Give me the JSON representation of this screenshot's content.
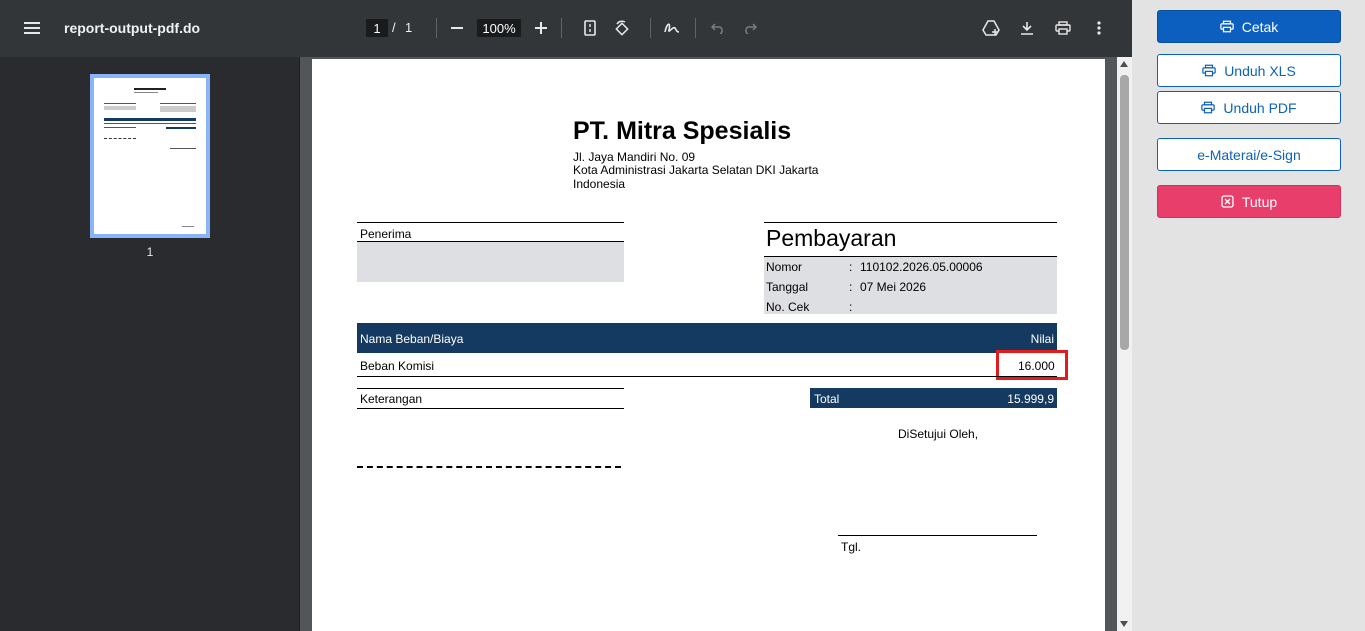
{
  "viewer": {
    "filename": "report-output-pdf.do",
    "current_page": "1",
    "page_separator": "/",
    "total_pages": "1",
    "zoom": "100%",
    "thumbnail_label": "1"
  },
  "document": {
    "company_name": "PT. Mitra Spesialis",
    "address_lines": [
      "Jl. Jaya Mandiri No. 09",
      "Kota Administrasi Jakarta Selatan DKI Jakarta",
      "Indonesia"
    ],
    "recipient_label": "Penerima",
    "payment_title": "Pembayaran",
    "fields": [
      {
        "label": "Nomor",
        "sep": ":",
        "value": "110102.2026.05.00006"
      },
      {
        "label": "Tanggal",
        "sep": ":",
        "value": "07 Mei 2026"
      },
      {
        "label": "No. Cek",
        "sep": ":",
        "value": ""
      }
    ],
    "table_header": {
      "name": "Nama Beban/Biaya",
      "value": "Nilai"
    },
    "rows": [
      {
        "name": "Beban Komisi",
        "value": "16.000"
      }
    ],
    "notes_label": "Keterangan",
    "total_label": "Total",
    "total_value": "15.999,9",
    "approved_by": "DiSetujui Oleh,",
    "date_label": "Tgl."
  },
  "actions": {
    "print": "Cetak",
    "download_xls": "Unduh XLS",
    "download_pdf": "Unduh PDF",
    "e_stamp": "e-Materai/e-Sign",
    "close": "Tutup"
  },
  "colors": {
    "toolbar": "#323639",
    "primary": "#0d5fbf",
    "danger": "#e83e6c",
    "table_header": "#153a61",
    "highlight": "#e21c1c"
  }
}
